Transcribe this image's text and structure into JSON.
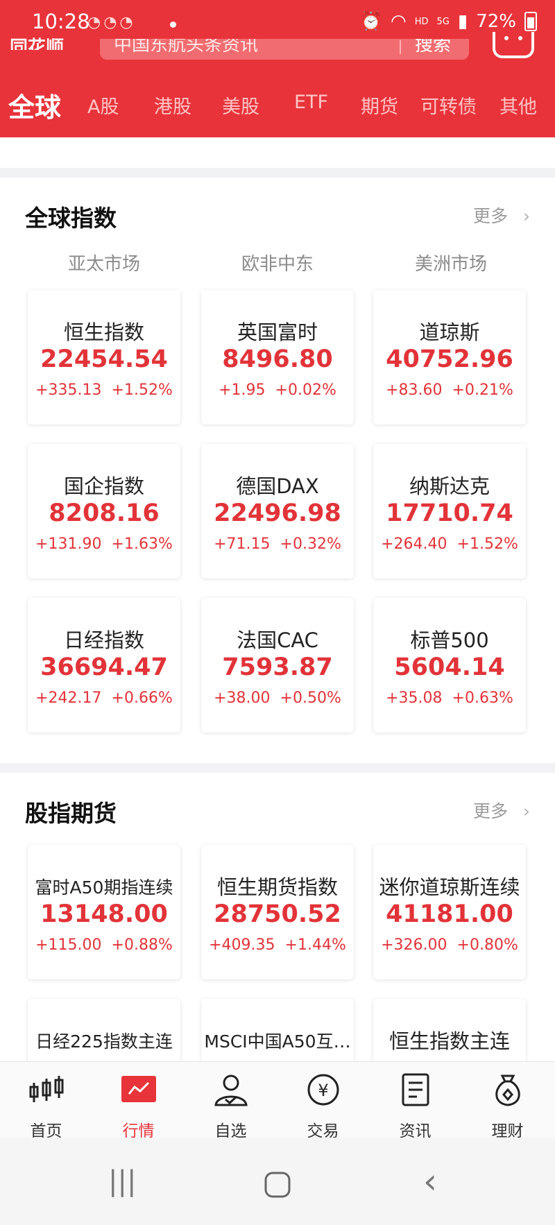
{
  "status": {
    "time": "10:28",
    "hd": "HD",
    "net": "5G",
    "battery": "72%"
  },
  "header": {
    "logo": "同花顺",
    "search_placeholder": "中国东航头条资讯",
    "search_button": "搜索",
    "tabs": [
      "全球",
      "A股",
      "港股",
      "美股",
      "ETF",
      "期货",
      "可转债",
      "其他"
    ]
  },
  "global_indices": {
    "title": "全球指数",
    "more": "更多",
    "regions": [
      "亚太市场",
      "欧非中东",
      "美洲市场"
    ],
    "cards": [
      {
        "name": "恒生指数",
        "price": "22454.54",
        "change": "+335.13",
        "pct": "+1.52%"
      },
      {
        "name": "英国富时",
        "price": "8496.80",
        "change": "+1.95",
        "pct": "+0.02%"
      },
      {
        "name": "道琼斯",
        "price": "40752.96",
        "change": "+83.60",
        "pct": "+0.21%"
      },
      {
        "name": "国企指数",
        "price": "8208.16",
        "change": "+131.90",
        "pct": "+1.63%"
      },
      {
        "name": "德国DAX",
        "price": "22496.98",
        "change": "+71.15",
        "pct": "+0.32%"
      },
      {
        "name": "纳斯达克",
        "price": "17710.74",
        "change": "+264.40",
        "pct": "+1.52%"
      },
      {
        "name": "日经指数",
        "price": "36694.47",
        "change": "+242.17",
        "pct": "+0.66%"
      },
      {
        "name": "法国CAC",
        "price": "7593.87",
        "change": "+38.00",
        "pct": "+0.50%"
      },
      {
        "name": "标普500",
        "price": "5604.14",
        "change": "+35.08",
        "pct": "+0.63%"
      }
    ]
  },
  "futures": {
    "title": "股指期货",
    "more": "更多",
    "cards": [
      {
        "name": "富时A50期指连续",
        "price": "13148.00",
        "change": "+115.00",
        "pct": "+0.88%"
      },
      {
        "name": "恒生期货指数",
        "price": "28750.52",
        "change": "+409.35",
        "pct": "+1.44%"
      },
      {
        "name": "迷你道琼斯连续",
        "price": "41181.00",
        "change": "+326.00",
        "pct": "+0.80%"
      },
      {
        "name": "日经225指数主连",
        "price": "",
        "change": "",
        "pct": ""
      },
      {
        "name": "MSCI中国A50互…",
        "price": "",
        "change": "",
        "pct": ""
      },
      {
        "name": "恒生指数主连",
        "price": "",
        "change": "",
        "pct": ""
      }
    ]
  },
  "bottom_nav": [
    {
      "label": "首页",
      "icon": "candlestick-icon"
    },
    {
      "label": "行情",
      "icon": "market-chart-icon"
    },
    {
      "label": "自选",
      "icon": "user-watchlist-icon"
    },
    {
      "label": "交易",
      "icon": "yen-coin-icon"
    },
    {
      "label": "资讯",
      "icon": "news-document-icon"
    },
    {
      "label": "理财",
      "icon": "money-bag-icon"
    }
  ],
  "colors": {
    "brand": "#e8333a",
    "up": "#e23338"
  }
}
